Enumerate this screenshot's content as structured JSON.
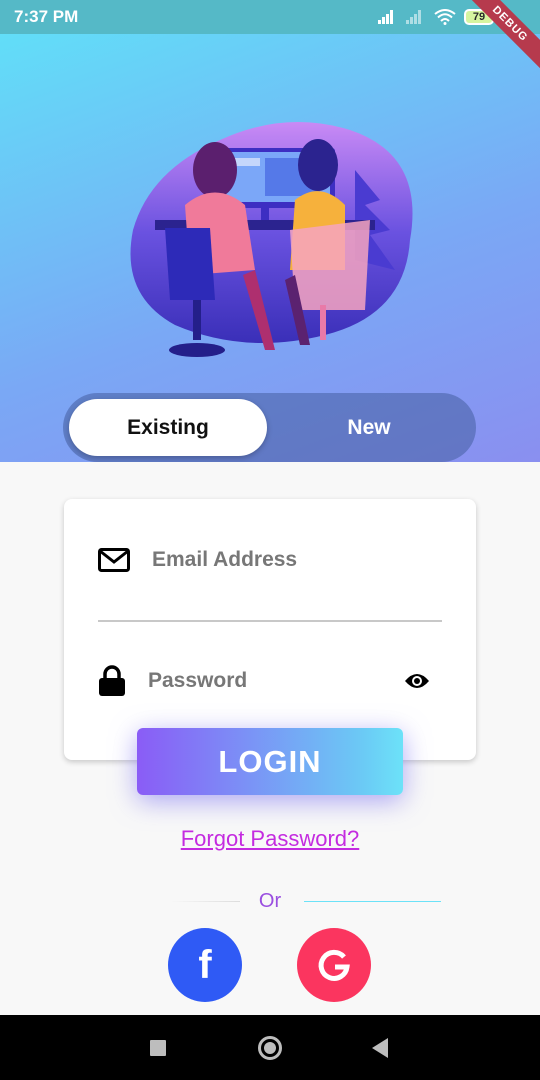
{
  "status_bar": {
    "time": "7:37 PM",
    "battery": "79",
    "debug": "DEBUG"
  },
  "auth_toggle": {
    "existing_label": "Existing",
    "new_label": "New",
    "selected": "Existing"
  },
  "login_form": {
    "email_placeholder": "Email Address",
    "password_placeholder": "Password",
    "login_label": "LOGIN",
    "forgot_label": "Forgot Password?"
  },
  "social": {
    "or_label": "Or",
    "facebook_glyph": "f",
    "google_glyph": "G"
  },
  "colors": {
    "accent_purple": "#8a5cf6",
    "accent_cyan": "#6ce2f8",
    "facebook": "#2f5af5",
    "google": "#fb355f",
    "link": "#c42be0"
  }
}
